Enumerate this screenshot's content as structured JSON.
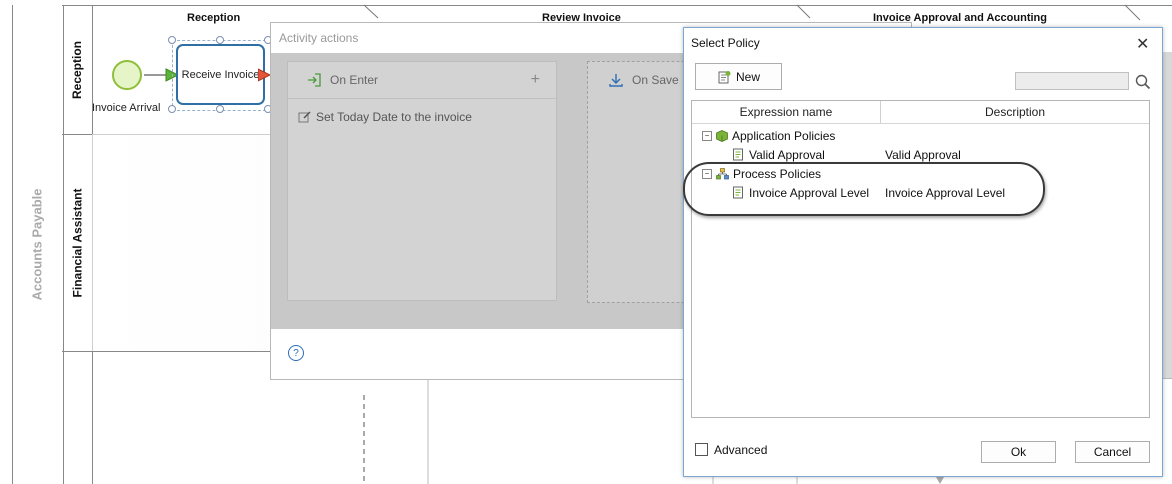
{
  "pool": {
    "label": "Accounts Payable"
  },
  "lanes": [
    {
      "label": "Reception"
    },
    {
      "label": "Financial Assistant"
    }
  ],
  "phases": [
    {
      "label": "Reception"
    },
    {
      "label": "Review Invoice"
    },
    {
      "label": "Invoice Approval and Accounting"
    }
  ],
  "diagram": {
    "start_event_label": "Invoice Arrival",
    "task_label": "Receive Invoice"
  },
  "activity_actions": {
    "title": "Activity actions",
    "on_enter_label": "On Enter",
    "add_symbol": "+",
    "on_save_label": "On Save",
    "action_item": "Set Today Date to the invoice",
    "help_symbol": "?"
  },
  "select_policy": {
    "title": "Select Policy",
    "close_symbol": "✕",
    "new_button_label": "New",
    "search_value": "",
    "columns": {
      "name": "Expression name",
      "description": "Description"
    },
    "groups": [
      {
        "label": "Application Policies",
        "expander": "−",
        "items": [
          {
            "name": "Valid Approval",
            "description": "Valid Approval"
          }
        ]
      },
      {
        "label": "Process Policies",
        "expander": "−",
        "items": [
          {
            "name": "Invoice Approval Level",
            "description": "Invoice Approval Level"
          }
        ]
      }
    ],
    "advanced_label": "Advanced",
    "ok_label": "Ok",
    "cancel_label": "Cancel"
  },
  "colors": {
    "start_event_fill": "#e6f5c8",
    "start_event_stroke": "#8fbf3a",
    "task_stroke": "#2f6fa5",
    "accent_blue": "#2d6db5",
    "on_enter_green": "#4a9a3a",
    "application_icon_green": "#7bb33a"
  }
}
